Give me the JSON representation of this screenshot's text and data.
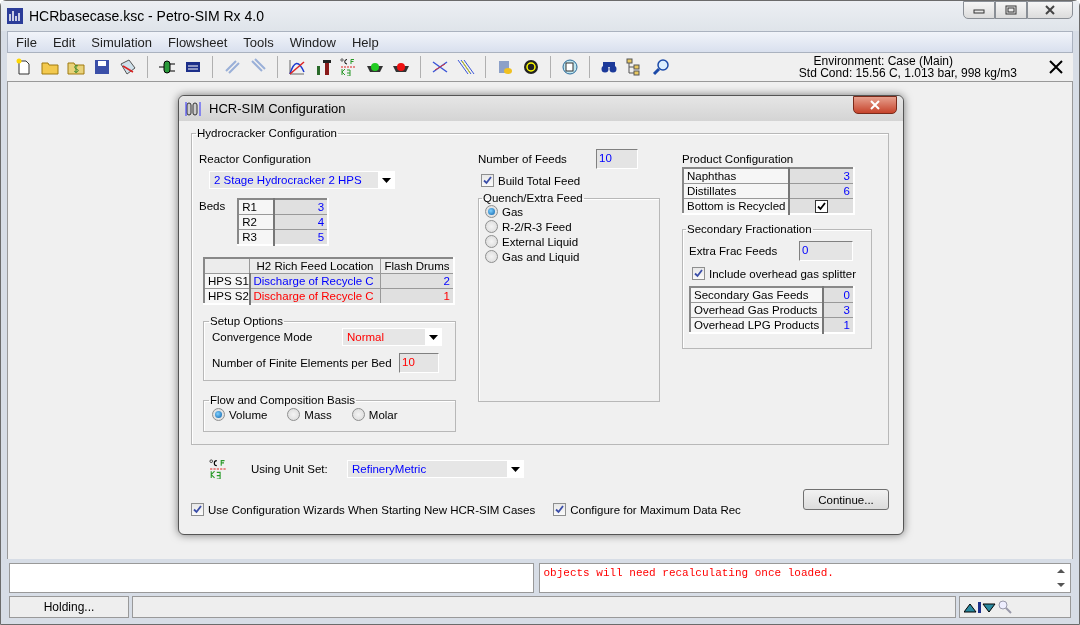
{
  "window": {
    "title": "HCRbasecase.ksc - Petro-SIM Rx 4.0"
  },
  "menu": [
    "File",
    "Edit",
    "Simulation",
    "Flowsheet",
    "Tools",
    "Window",
    "Help"
  ],
  "environment": {
    "case": "Environment: Case (Main)",
    "std_cond": "Std Cond: 15.56 C, 1.013 bar, 998 kg/m3"
  },
  "dialog": {
    "title": "HCR-SIM Configuration",
    "hydrocracker": {
      "title": "Hydrocracker Configuration",
      "reactor_label": "Reactor Configuration",
      "reactor_value": "2 Stage Hydrocracker 2 HPS",
      "beds_label": "Beds",
      "beds": [
        {
          "name": "R1",
          "value": "3"
        },
        {
          "name": "R2",
          "value": "4"
        },
        {
          "name": "R3",
          "value": "5"
        }
      ],
      "hps_table": {
        "columns": [
          "H2 Rich Feed Location",
          "Flash Drums"
        ],
        "rows": [
          {
            "name": "HPS S1",
            "location": "Discharge of Recycle C",
            "drums": "2",
            "default": false
          },
          {
            "name": "HPS S2",
            "location": "Discharge of Recycle C",
            "drums": "1",
            "default": true
          }
        ]
      },
      "setup": {
        "title": "Setup Options",
        "convergence_label": "Convergence Mode",
        "convergence_value": "Normal",
        "convergence_default": true,
        "elements_label": "Number of Finite Elements per Bed",
        "elements_value": "10",
        "elements_default": true
      },
      "basis": {
        "title": "Flow and Composition Basis",
        "options": [
          {
            "label": "Volume",
            "selected": true
          },
          {
            "label": "Mass",
            "selected": false
          },
          {
            "label": "Molar",
            "selected": false
          }
        ]
      },
      "feeds_label": "Number of Feeds",
      "feeds_value": "10",
      "build_total_feed": {
        "label": "Build Total Feed",
        "checked": true
      },
      "quench": {
        "title": "Quench/Extra Feed",
        "options": [
          {
            "label": "Gas",
            "selected": true
          },
          {
            "label": "R-2/R-3 Feed",
            "selected": false
          },
          {
            "label": "External Liquid",
            "selected": false
          },
          {
            "label": "Gas and Liquid",
            "selected": false
          }
        ]
      },
      "product": {
        "title": "Product Configuration",
        "rows": [
          {
            "name": "Naphthas",
            "kind": "number",
            "value": "3"
          },
          {
            "name": "Distillates",
            "kind": "number",
            "value": "6"
          },
          {
            "name": "Bottom is Recycled",
            "kind": "check",
            "checked": true
          }
        ]
      },
      "secondary": {
        "title": "Secondary Fractionation",
        "extra_label": "Extra Frac Feeds",
        "extra_value": "0",
        "splitter": {
          "label": "Include overhead gas splitter",
          "checked": true
        },
        "rows": [
          {
            "name": "Secondary Gas Feeds",
            "value": "0"
          },
          {
            "name": "Overhead Gas Products",
            "value": "3"
          },
          {
            "name": "Overhead LPG Products",
            "value": "1"
          }
        ]
      }
    },
    "unit_set": {
      "label": "Using Unit Set:",
      "value": "RefineryMetric"
    },
    "options": [
      {
        "label": "Use Configuration Wizards When Starting New HCR-SIM Cases",
        "checked": true
      },
      {
        "label": "Configure for Maximum Data Rec",
        "checked": true
      }
    ],
    "continue_button": "Continue..."
  },
  "message_panel": {
    "text": "objects will need recalculating once loaded."
  },
  "status_bar": {
    "status": "Holding..."
  }
}
